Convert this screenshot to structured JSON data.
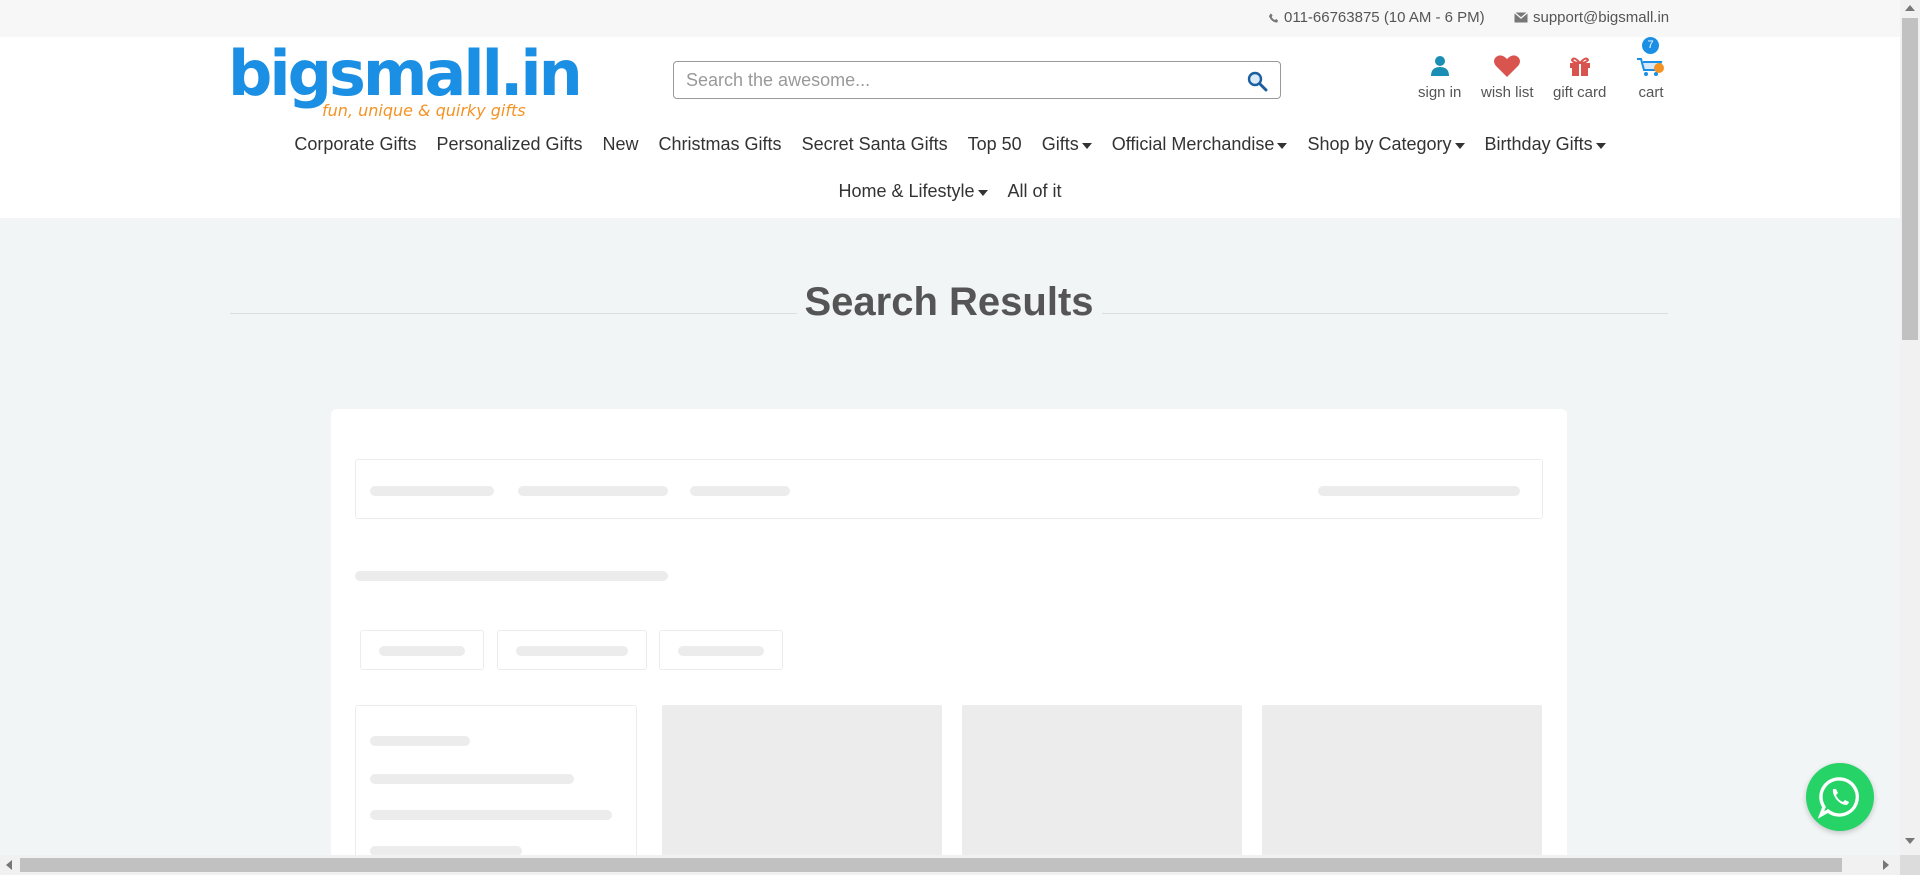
{
  "topbar": {
    "phone": "011-66763875 (10 AM - 6 PM)",
    "email": "support@bigsmall.in"
  },
  "logo": {
    "name": "bigsmall.in",
    "tagline": "fun, unique & quirky gifts"
  },
  "search": {
    "placeholder": "Search the awesome...",
    "value": ""
  },
  "account": {
    "signin": "sign in",
    "wishlist": "wish list",
    "giftcard": "gift card",
    "cart": "cart",
    "cart_count": "7"
  },
  "nav": {
    "row1": [
      {
        "label": "Corporate Gifts",
        "dropdown": false
      },
      {
        "label": "Personalized Gifts",
        "dropdown": false
      },
      {
        "label": "New",
        "dropdown": false
      },
      {
        "label": "Christmas Gifts",
        "dropdown": false
      },
      {
        "label": "Secret Santa Gifts",
        "dropdown": false
      },
      {
        "label": "Top 50",
        "dropdown": false
      },
      {
        "label": "Gifts",
        "dropdown": true
      },
      {
        "label": "Official Merchandise",
        "dropdown": true
      },
      {
        "label": "Shop by Category",
        "dropdown": true
      },
      {
        "label": "Birthday Gifts",
        "dropdown": true
      }
    ],
    "row2": [
      {
        "label": "Home & Lifestyle",
        "dropdown": true
      },
      {
        "label": "All of it",
        "dropdown": false
      }
    ]
  },
  "page": {
    "title": "Search Results"
  },
  "colors": {
    "brand_blue": "#1a8fe3",
    "brand_orange": "#f39324",
    "whatsapp_green": "#25d366",
    "wishlist_red": "#d9534f",
    "signin_teal": "#1a8fb3"
  },
  "icons": {
    "phone": "phone-icon",
    "email": "envelope-icon",
    "search": "magnifier-icon",
    "signin": "user-icon",
    "wishlist": "heart-icon",
    "giftcard": "gift-icon",
    "cart": "cart-icon",
    "whatsapp": "whatsapp-icon"
  }
}
